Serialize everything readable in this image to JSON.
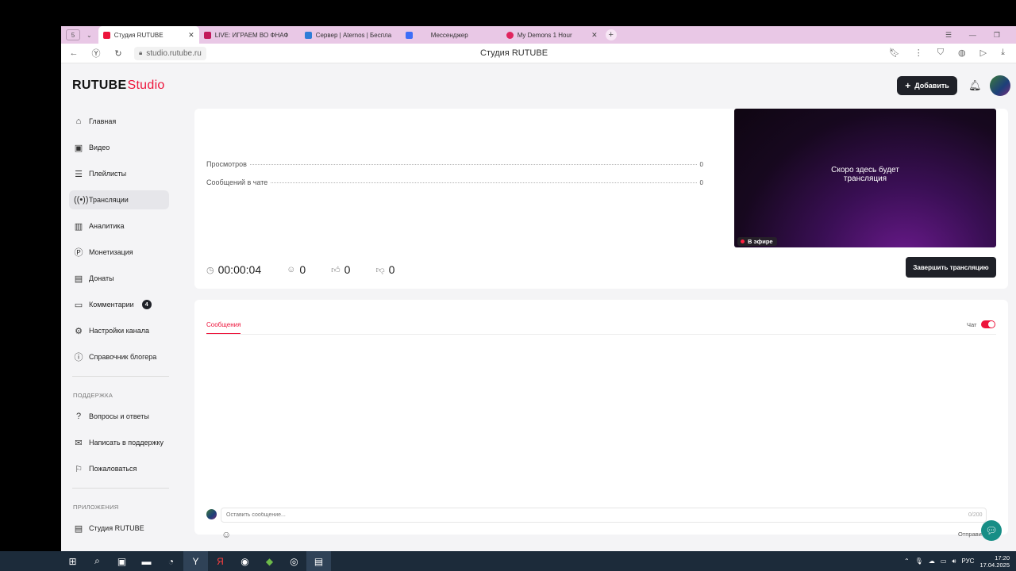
{
  "browser": {
    "tab_count": "5",
    "tabs": [
      {
        "title": "Студия RUTUBE",
        "color": "#ed143b",
        "active": true
      },
      {
        "title": "LIVE: ИГРАЕМ ВО ФНАФ",
        "color": "#c2185b",
        "active": false
      },
      {
        "title": "Сервер | Aternos | Беспла",
        "color": "#2e7dd7",
        "active": false
      },
      {
        "title": "Мессенджер",
        "color": "#3d6ef7",
        "active": false
      },
      {
        "title": "My Demons 1 Hour",
        "color": "#e0245e",
        "active": false
      }
    ],
    "url": "studio.rutube.ru",
    "page_title": "Студия RUTUBE"
  },
  "header": {
    "logo_main": "RUTUBE",
    "logo_studio": "Studio",
    "add_label": "Добавить"
  },
  "sidebar": {
    "items": [
      {
        "label": "Главная",
        "icon": "home-icon"
      },
      {
        "label": "Видео",
        "icon": "video-icon"
      },
      {
        "label": "Плейлисты",
        "icon": "playlist-icon"
      },
      {
        "label": "Трансляции",
        "icon": "broadcast-icon"
      },
      {
        "label": "Аналитика",
        "icon": "analytics-icon"
      },
      {
        "label": "Монетизация",
        "icon": "monetization-icon"
      },
      {
        "label": "Донаты",
        "icon": "wallet-icon"
      },
      {
        "label": "Комментарии",
        "icon": "comment-icon",
        "badge": "4"
      },
      {
        "label": "Настройки канала",
        "icon": "gear-icon"
      },
      {
        "label": "Справочник блогера",
        "icon": "info-icon"
      }
    ],
    "support_heading": "ПОДДЕРЖКА",
    "support_items": [
      {
        "label": "Вопросы и ответы",
        "icon": "question-icon"
      },
      {
        "label": "Написать в поддержку",
        "icon": "mail-icon"
      },
      {
        "label": "Пожаловаться",
        "icon": "flag-icon"
      }
    ],
    "apps_heading": "ПРИЛОЖЕНИЯ",
    "apps_items": [
      {
        "label": "Студия RUTUBE",
        "icon": "studio-icon"
      }
    ]
  },
  "stats": {
    "views_label": "Просмотров",
    "views_value": "0",
    "chat_label": "Сообщений в чате",
    "chat_value": "0"
  },
  "preview": {
    "soon_text_line1": "Скоро здесь будет",
    "soon_text_line2": "трансляция",
    "live_label": "В эфире"
  },
  "metrics": {
    "duration": "00:00:04",
    "viewers": "0",
    "likes": "0",
    "dislikes": "0"
  },
  "end_button": "Завершить трансляцию",
  "chat": {
    "tab_label": "Сообщения",
    "toggle_label": "Чат",
    "input_placeholder": "Оставить сообщение...",
    "counter": "0/200",
    "send_label": "Отправить"
  },
  "taskbar": {
    "lang": "РУС",
    "time": "17:20",
    "date": "17.04.2025"
  }
}
